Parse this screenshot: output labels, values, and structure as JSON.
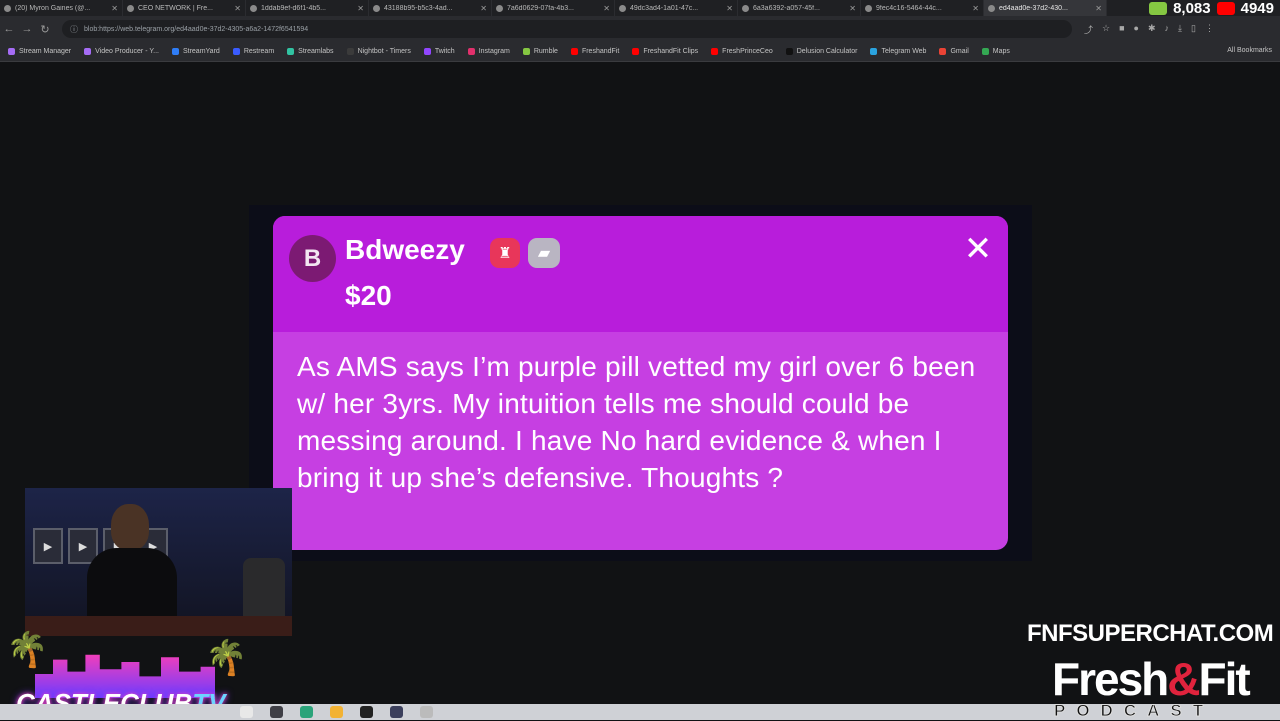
{
  "browser": {
    "tabs": [
      {
        "label": "(20) Myron Gaines (@..."
      },
      {
        "label": "CEO NETWORK | Fre..."
      },
      {
        "label": "1ddab9ef-d6f1-4b5..."
      },
      {
        "label": "43188b95-b5c3-4ad..."
      },
      {
        "label": "7a6d0629-07fa-4b3..."
      },
      {
        "label": "49dc3ad4-1a01-47c..."
      },
      {
        "label": "6a3a6392-a057-45f..."
      },
      {
        "label": "9fec4c16-5464-44c..."
      },
      {
        "label": "ed4aad0e-37d2-430..."
      }
    ],
    "url": "blob:https://web.telegram.org/ed4aad0e-37d2-4305-a6a2-1472f6541594",
    "bookmarks": [
      {
        "label": "Stream Manager",
        "color": "#a56cf5"
      },
      {
        "label": "Video Producer - Y...",
        "color": "#a56cf5"
      },
      {
        "label": "StreamYard",
        "color": "#2f7df6"
      },
      {
        "label": "Restream",
        "color": "#3a5cff"
      },
      {
        "label": "Streamlabs",
        "color": "#31c3a2"
      },
      {
        "label": "Nightbot - Timers",
        "color": "#3b3b3b"
      },
      {
        "label": "Twitch",
        "color": "#9146ff"
      },
      {
        "label": "Instagram",
        "color": "#e1306c"
      },
      {
        "label": "Rumble",
        "color": "#85c742"
      },
      {
        "label": "FreshandFit",
        "color": "#ff0000"
      },
      {
        "label": "FreshandFit Clips",
        "color": "#ff0000"
      },
      {
        "label": "FreshPrinceCeo",
        "color": "#ff0000"
      },
      {
        "label": "Delusion Calculator",
        "color": "#111111"
      },
      {
        "label": "Telegram Web",
        "color": "#2aa3df"
      },
      {
        "label": "Gmail",
        "color": "#ea4335"
      },
      {
        "label": "Maps",
        "color": "#34a853"
      }
    ],
    "all_bookmarks": "All Bookmarks"
  },
  "counters": {
    "rumble": "8,083",
    "youtube": "4949",
    "rumble_color": "#85c742",
    "youtube_color": "#ff0000"
  },
  "superchat": {
    "avatar_letter": "B",
    "username": "Bdweezy",
    "amount": "$20",
    "message": "As AMS says I’m purple pill vetted my girl over 6 been w/ her 3yrs. My intuition tells me should could be messing around. I have No hard evidence & when I bring it up she’s defensive. Thoughts ?",
    "header_color": "#b81ddb",
    "body_color": "#c63fe2",
    "badges": [
      "crown-badge-icon",
      "image-badge-icon"
    ]
  },
  "overlay": {
    "site": "FNFSUPERCHAT.COM",
    "brand_fresh": "Fresh",
    "brand_amp": "&",
    "brand_fit": "Fit",
    "brand_podcast": "PODCAST",
    "club_name": "CASTLECLUB",
    "club_tv": "TV"
  },
  "webcam": {
    "frame_badges": [
      "▶",
      "▶",
      "▶",
      "▶"
    ]
  }
}
